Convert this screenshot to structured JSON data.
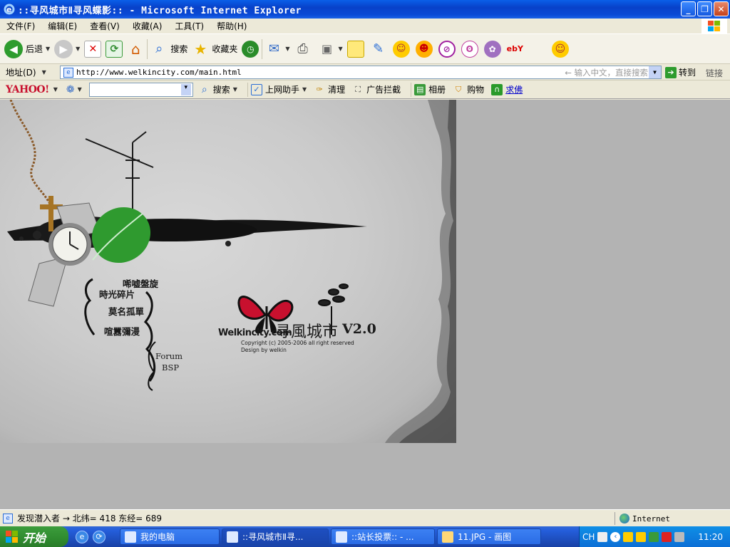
{
  "window": {
    "title": "::寻风城市Ⅱ寻风蝶影:: - Microsoft Internet Explorer",
    "min_label": "_",
    "max_label": "❐",
    "close_label": "✕"
  },
  "menu": {
    "items": [
      "文件(F)",
      "编辑(E)",
      "查看(V)",
      "收藏(A)",
      "工具(T)",
      "帮助(H)"
    ]
  },
  "toolbar": {
    "back_label": "后退",
    "search_label": "搜索",
    "favorites_label": "收藏夹",
    "ebay_label": "ebY"
  },
  "address": {
    "label": "地址(D)",
    "url": "http://www.welkincity.com/main.html",
    "search_placeholder": "输入中文，直接搜索",
    "go_label": "转到",
    "links_label": "链接"
  },
  "yahoo_bar": {
    "logo": "YAHOO!",
    "search_label": "搜索",
    "assistant_label": "上网助手",
    "clean_label": "清理",
    "adblock_label": "广告拦截",
    "album_label": "相册",
    "shop_label": "购物",
    "qiufo_label": "求佛"
  },
  "page": {
    "nav": {
      "item1": "唏嘘盤旋",
      "item2": "時光碎片",
      "item3": "莫名孤單",
      "item4": "喧囂彌漫",
      "item5": "Forum",
      "item6": "BSP"
    },
    "logo": {
      "site": "Welkincity.com",
      "title": "寻風城市",
      "version": "V2.0",
      "copyright": "Copyright (c) 2005-2006 all right reserved",
      "design": "Design by welkin"
    }
  },
  "status": {
    "text": "发现潜入者 →  北纬= 418  东经= 689",
    "zone": "Internet"
  },
  "taskbar": {
    "start_label": "开始",
    "tasks": [
      {
        "label": "我的电脑"
      },
      {
        "label": "::寻风城市Ⅱ寻..."
      },
      {
        "label": "::站长投票:: - ..."
      },
      {
        "label": "11.JPG - 画图"
      }
    ],
    "lang": "CH",
    "clock": "11:20"
  },
  "colors": {
    "titlebar": "#0a4ad6",
    "butterfly_red": "#c8102e",
    "leaf_green": "#2f9a2f",
    "content_bg": "#b3b3b3"
  }
}
